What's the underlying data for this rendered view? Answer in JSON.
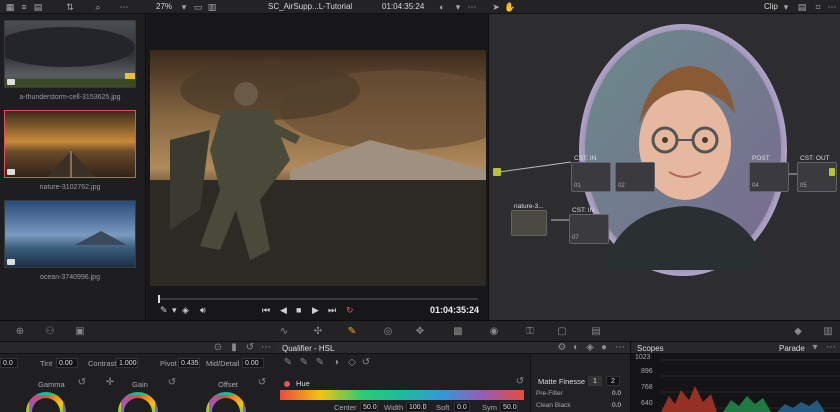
{
  "topbar": {
    "zoom": "27%",
    "project": "SC_AirSupp...L-Tutorial",
    "timecode": "01:04:35:24",
    "mode": "Clip"
  },
  "media": {
    "clips": [
      {
        "label": "a-thunderstorm-cell-3153625.jpg",
        "selected": false
      },
      {
        "label": "nature-3102762.jpg",
        "selected": true
      },
      {
        "label": "ocean-3740996.jpg",
        "selected": false
      }
    ]
  },
  "viewer": {
    "timecode": "01:04:35:24"
  },
  "nodes": {
    "items": [
      {
        "label": "CST: IN",
        "num": "01"
      },
      {
        "label": "",
        "num": "02"
      },
      {
        "label": "POST",
        "num": "04"
      },
      {
        "label": "CST: OUT",
        "num": "05"
      },
      {
        "label": "CST: IN",
        "num": "07"
      },
      {
        "label": "nature-3...",
        "num": ""
      }
    ]
  },
  "primaries": {
    "fields": {
      "left_value": "0.0",
      "tint_label": "Tint",
      "tint": "0.00",
      "contrast_label": "Contrast",
      "contrast": "1.000",
      "pivot_label": "Pivot",
      "pivot": "0.435",
      "middetail_label": "Mid/Detail",
      "middetail": "0.00"
    },
    "wheels": [
      {
        "label": "Gamma"
      },
      {
        "label": "Gain"
      },
      {
        "label": "Offset"
      }
    ]
  },
  "qualifier": {
    "title": "Qualifier - HSL",
    "hue_label": "Hue",
    "center_label": "Center",
    "center": "50.0",
    "width_label": "Width",
    "width": "100.0",
    "soft_label": "Soft",
    "soft": "0.0",
    "sym_label": "Sym",
    "sym": "50.0"
  },
  "matte": {
    "title": "Matte Finesse",
    "btn1": "1",
    "btn2": "2",
    "prefilter_label": "Pre-Filter",
    "prefilter": "0.0",
    "cleanblack_label": "Clean Black",
    "cleanblack": "0.0"
  },
  "scopes": {
    "title": "Scopes",
    "mode": "Parade",
    "ticks": [
      "1023",
      "896",
      "768",
      "640"
    ]
  },
  "colors": {
    "accent": "#e0545a",
    "highlight": "#f1a93a"
  }
}
